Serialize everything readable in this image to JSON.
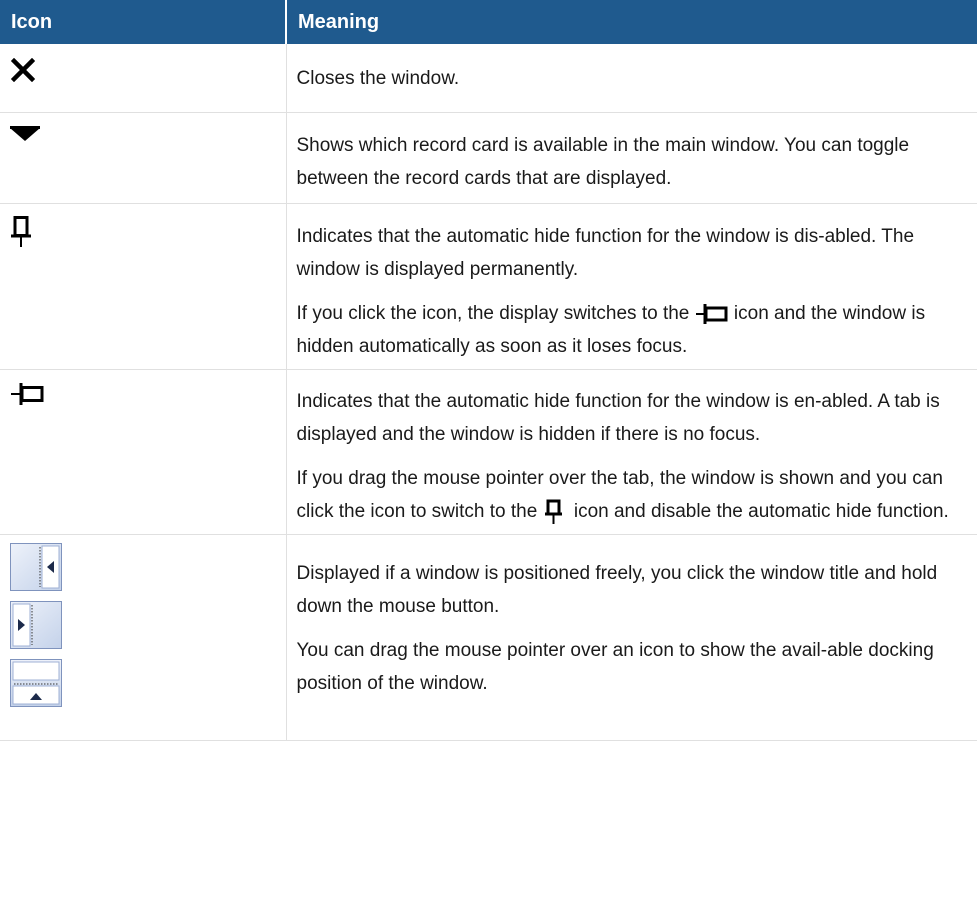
{
  "table": {
    "headers": {
      "icon": "Icon",
      "meaning": "Meaning"
    },
    "rows": [
      {
        "icon": "close-x-icon",
        "paragraphs": [
          {
            "text": "Closes the window."
          }
        ]
      },
      {
        "icon": "dropdown-triangle-icon",
        "paragraphs": [
          {
            "text": "Shows which record card is available in the main window. You can toggle between the record cards that are displayed."
          }
        ]
      },
      {
        "icon": "pin-vertical-icon",
        "paragraphs": [
          {
            "text": "Indicates that the automatic hide function for the window is dis-abled. The window is displayed permanently."
          },
          {
            "before": "If you click the icon, the display switches to the ",
            "inline_icon": "pin-horizontal-icon",
            "after": " icon and the window is hidden automatically as soon as it loses focus."
          }
        ]
      },
      {
        "icon": "pin-horizontal-icon",
        "paragraphs": [
          {
            "text": "Indicates that the automatic hide function for the window is en-abled. A tab is displayed and the window is hidden if there is no focus."
          },
          {
            "before": "If you drag the mouse pointer over the tab, the window is shown and you can click the icon to switch to the ",
            "inline_icon": "pin-vertical-icon",
            "after": " icon and disable the automatic hide function."
          }
        ]
      },
      {
        "icons": [
          "dock-right-icon",
          "dock-left-icon",
          "dock-bottom-icon"
        ],
        "paragraphs": [
          {
            "text": "Displayed if a window is positioned freely, you click the window title and hold down the mouse button."
          },
          {
            "text": "You can drag the mouse pointer over an icon to show the avail-able docking position of the window."
          }
        ]
      }
    ]
  }
}
